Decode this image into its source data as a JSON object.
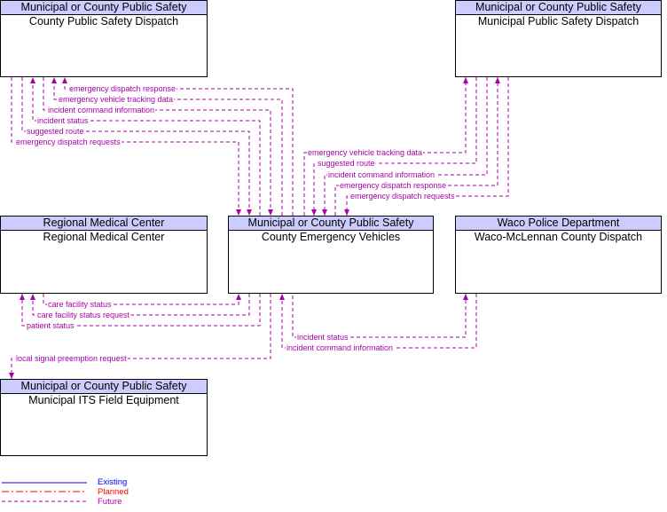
{
  "boxes": {
    "cpsd": {
      "header": "Municipal or County Public Safety",
      "name": "County Public Safety Dispatch"
    },
    "mpsd": {
      "header": "Municipal or County Public Safety",
      "name": "Municipal Public Safety Dispatch"
    },
    "rmc": {
      "header": "Regional Medical Center",
      "name": "Regional Medical Center"
    },
    "cev": {
      "header": "Municipal or County Public Safety",
      "name": "County Emergency Vehicles"
    },
    "waco": {
      "header": "Waco Police Department",
      "name": "Waco-McLennan County Dispatch"
    },
    "mits": {
      "header": "Municipal or County Public Safety",
      "name": "Municipal ITS Field Equipment"
    }
  },
  "flows": [
    "emergency dispatch response",
    "emergency vehicle tracking data",
    "incident command information",
    "incident status",
    "suggested route",
    "emergency dispatch requests",
    "emergency vehicle tracking data",
    "suggested route",
    "incident command information",
    "emergency dispatch response",
    "emergency dispatch requests",
    "care facility status",
    "care facility status request",
    "patient status",
    "incident status",
    "incident command information",
    "local signal preemption request"
  ],
  "flow_status": "Future",
  "legend": {
    "existing": "Existing",
    "planned": "Planned",
    "future": "Future"
  },
  "colors": {
    "existing": "#0000ff",
    "planned": "#ff0000",
    "future": "#aa00aa",
    "header_bg": "#ccccff"
  }
}
